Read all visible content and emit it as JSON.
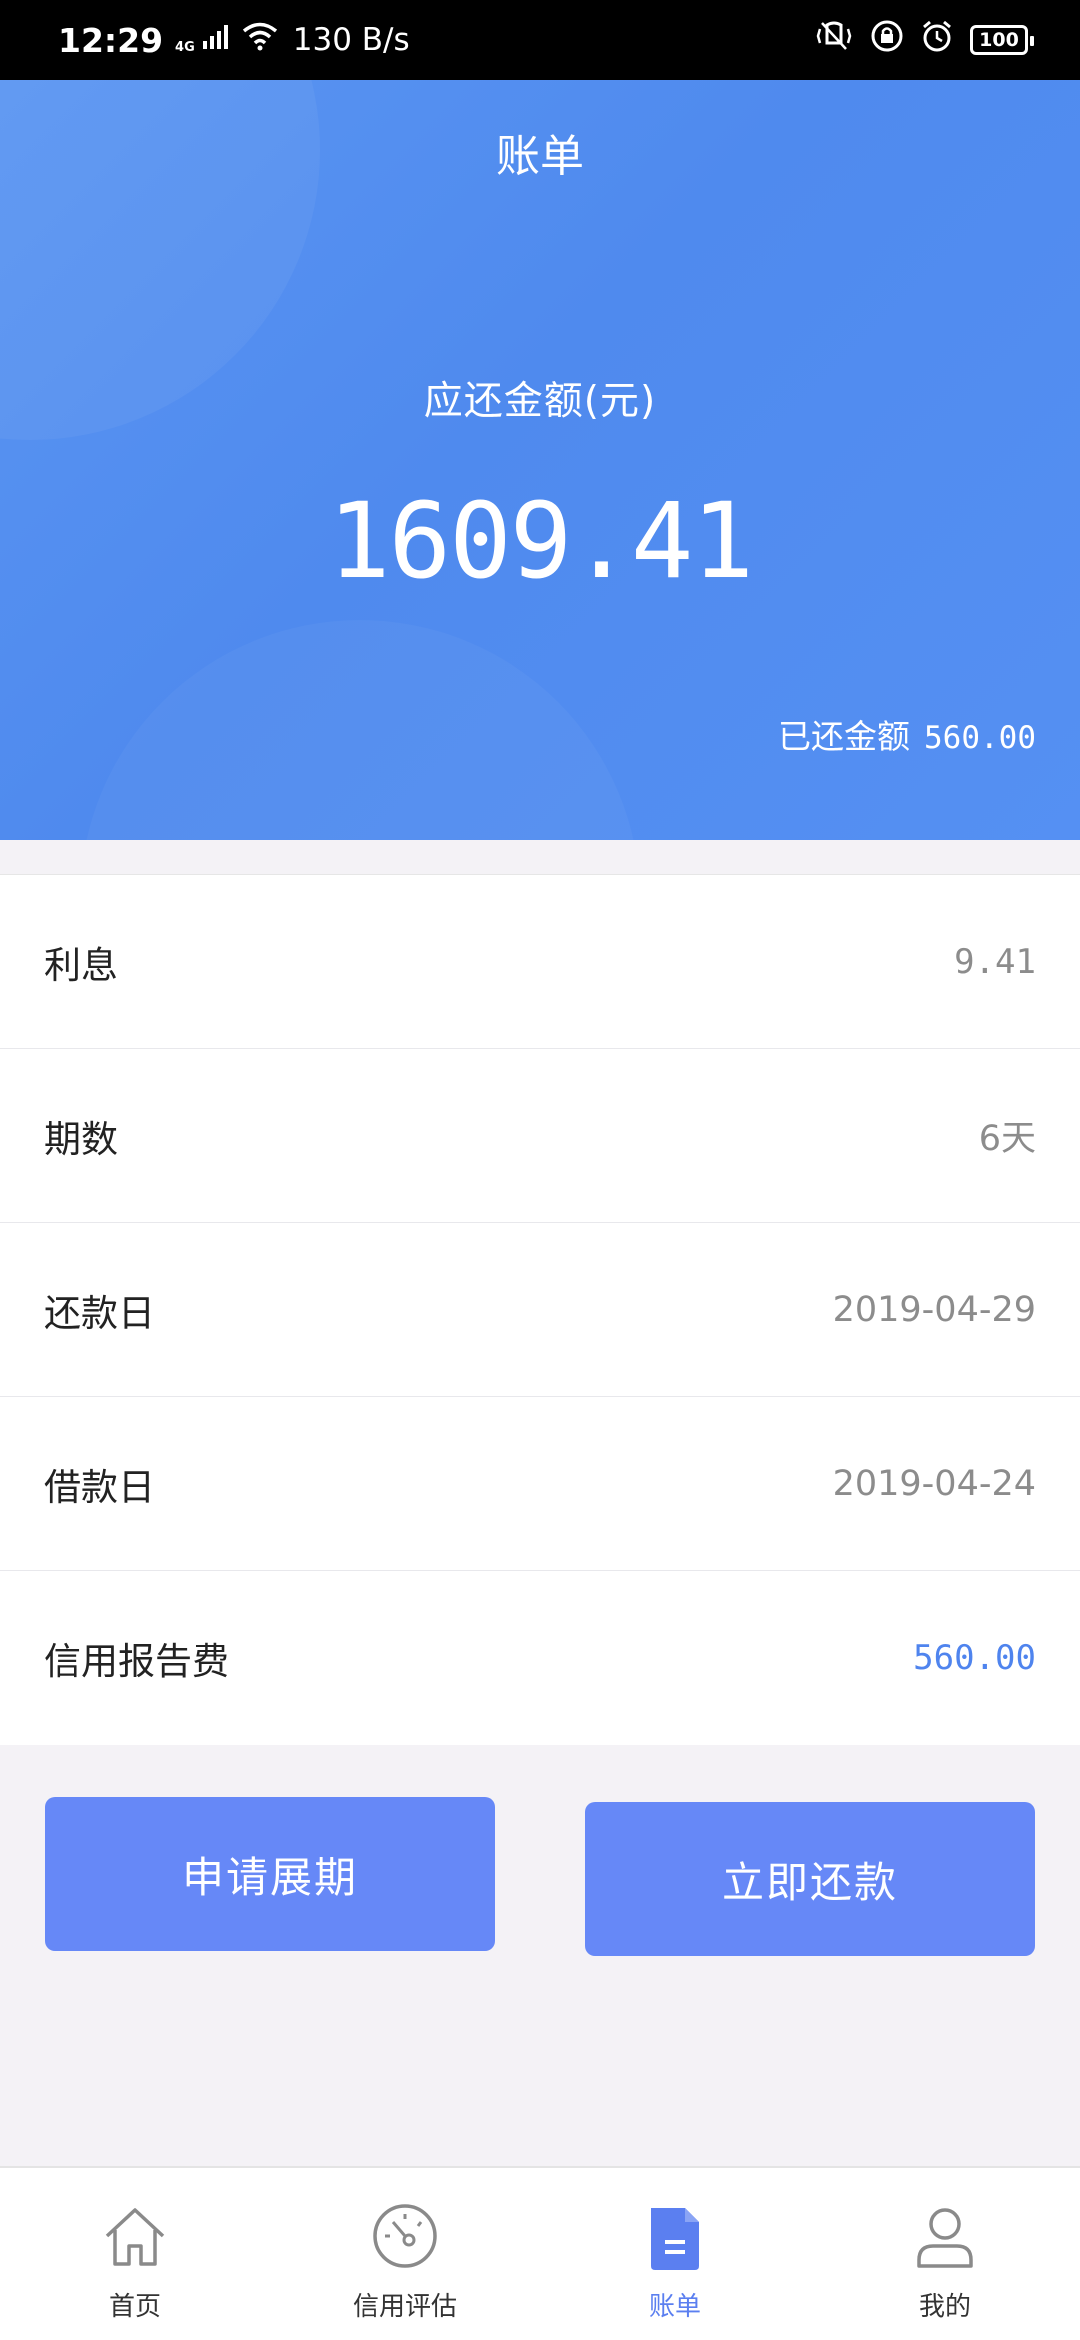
{
  "status_bar": {
    "time": "12:29",
    "network": "4G",
    "speed": "130 B/s",
    "battery": "100"
  },
  "header": {
    "title": "账单",
    "amount_label": "应还金额(元)",
    "amount_value": "1609.41",
    "paid_label": "已还金额",
    "paid_value": "560.00"
  },
  "details": [
    {
      "label": "利息",
      "value": "9.41"
    },
    {
      "label": "期数",
      "value": "6天"
    },
    {
      "label": "还款日",
      "value": "2019-04-29"
    },
    {
      "label": "借款日",
      "value": "2019-04-24"
    },
    {
      "label": "信用报告费",
      "value": "560.00"
    }
  ],
  "actions": {
    "extend_label": "申请展期",
    "repay_label": "立即还款"
  },
  "tab_bar": {
    "items": [
      {
        "label": "首页",
        "icon": "home-icon"
      },
      {
        "label": "信用评估",
        "icon": "gauge-icon"
      },
      {
        "label": "账单",
        "icon": "bill-icon",
        "active": true
      },
      {
        "label": "我的",
        "icon": "user-icon"
      }
    ]
  },
  "colors": {
    "header_blue": "#5590f3",
    "button_blue": "#6688f7",
    "accent_blue": "#4f84ee",
    "active_tab": "#5b7ff0"
  }
}
